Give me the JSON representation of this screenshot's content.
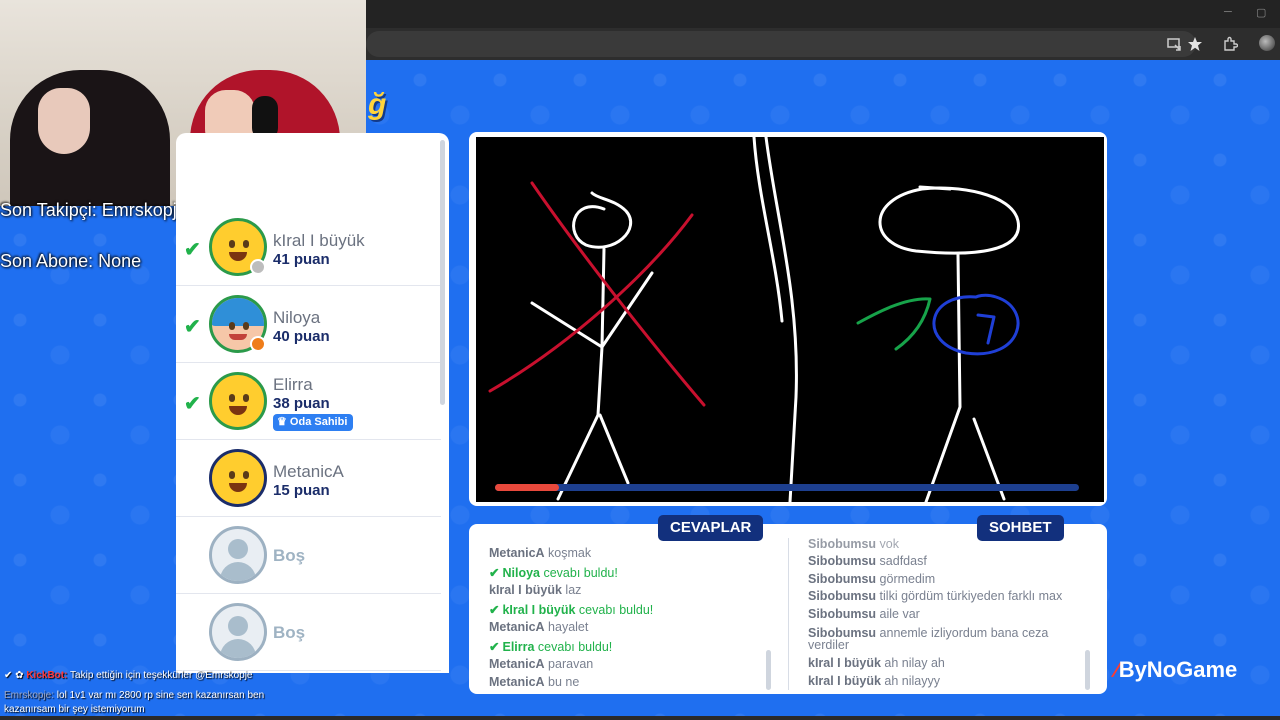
{
  "browser": {
    "minimize_glyph": "─",
    "maximize_glyph": "▢",
    "toolbar_icons": [
      "install-app-icon",
      "bookmark-star-icon",
      "extensions-icon",
      "profile-avatar-icon"
    ]
  },
  "game": {
    "logo_glyph": "ğ",
    "brand_mark": "⁄",
    "brand_name": "ByNoGame"
  },
  "stream_overlay": {
    "last_follower": "Son Takipçi: Emrskopje",
    "last_subscriber": "Son Abone: None",
    "chat": [
      {
        "prefix": "✔ ✿ ",
        "user": "KickBot:",
        "text": " Takip ettiğin için teşekkürler @Emrskopje"
      },
      {
        "user": "Emrskopje:",
        "text": " lol 1v1 var mı 2800 rp sine sen kazanırsan ben"
      },
      {
        "user": "",
        "text": "kazanırsam bir şey istemiyorum"
      }
    ]
  },
  "players": [
    {
      "name": "kIral I büyük",
      "score": "41 puan",
      "guessed": true,
      "avatar": "smiley-avatar-icon",
      "status_color": "#bdbdbd"
    },
    {
      "name": "Niloya",
      "score": "40 puan",
      "guessed": true,
      "avatar": "blue-hair-girl-avatar-icon",
      "status_color": "#ef7d1a"
    },
    {
      "name": "Elirra",
      "score": "38 puan",
      "guessed": true,
      "avatar": "smiley-avatar-icon",
      "badge": "Oda Sahibi"
    },
    {
      "name": "MetanicA",
      "score": "15 puan",
      "guessed": false,
      "avatar": "smiley-avatar-icon"
    },
    {
      "name": "Boş",
      "empty": true,
      "avatar": "empty-user-avatar-icon"
    },
    {
      "name": "Boş",
      "empty": true,
      "avatar": "empty-user-avatar-icon"
    }
  ],
  "check_glyph": "✔",
  "timer": {
    "remaining_fraction": 0.11
  },
  "tabs": {
    "answers": "CEVAPLAR",
    "chat": "SOHBET"
  },
  "answers": [
    {
      "user": "MetanicA",
      "text": " koşmak",
      "win": false
    },
    {
      "user": "Niloya",
      "text": " cevabı buldu!",
      "win": true
    },
    {
      "user": "kIral I büyük",
      "text": " laz",
      "win": false
    },
    {
      "user": "kIral I büyük",
      "text": " cevabı buldu!",
      "win": true
    },
    {
      "user": "MetanicA",
      "text": " hayalet",
      "win": false
    },
    {
      "user": "Elirra",
      "text": " cevabı buldu!",
      "win": true
    },
    {
      "user": "MetanicA",
      "text": " paravan",
      "win": false
    },
    {
      "user": "MetanicA",
      "text": " bu ne",
      "win": false
    }
  ],
  "chat_messages": [
    {
      "user": "Sibobumsu",
      "text": " yok"
    },
    {
      "user": "Sibobumsu",
      "text": " sadfdasf"
    },
    {
      "user": "Sibobumsu",
      "text": " görmedim"
    },
    {
      "user": "Sibobumsu",
      "text": " tilki gördüm türkiyeden farklı max"
    },
    {
      "user": "Sibobumsu",
      "text": " aile var"
    },
    {
      "user": "Sibobumsu",
      "text": " annemle izliyordum bana ceza verdiler"
    },
    {
      "user": "kIral I büyük",
      "text": " ah nilay ah"
    },
    {
      "user": "kIral I büyük",
      "text": " ah nilayyy"
    }
  ],
  "colors": {
    "page_bg": "#1f6ff0",
    "navy": "#12307d",
    "success": "#21b24b",
    "timer": "#e8493c"
  }
}
